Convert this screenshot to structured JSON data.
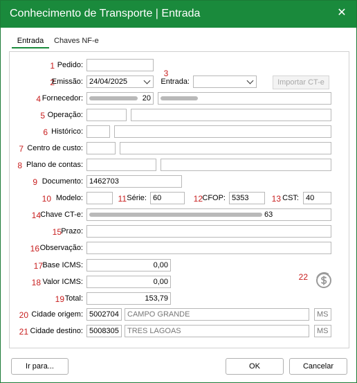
{
  "window": {
    "title": "Conhecimento de Transporte | Entrada",
    "close_icon": "close-icon"
  },
  "tabs": [
    {
      "label": "Entrada",
      "active": true
    },
    {
      "label": "Chaves NF-e",
      "active": false
    }
  ],
  "colors": {
    "titlebar": "#1a8a3c",
    "number": "#c81e1e"
  },
  "form": {
    "pedido": {
      "num": "1",
      "label": "Pedido:",
      "value": ""
    },
    "emissao": {
      "num": "2",
      "label": "Emissão:",
      "value": "24/04/2025"
    },
    "entrada": {
      "num": "3",
      "label": "Entrada:",
      "value": ""
    },
    "importar_label": "Importar CT-e",
    "fornecedor": {
      "num": "4",
      "label": "Fornecedor:",
      "code_suffix": "20"
    },
    "operacao": {
      "num": "5",
      "label": "Operação:"
    },
    "historico": {
      "num": "6",
      "label": "Histórico:"
    },
    "centro_custo": {
      "num": "7",
      "label": "Centro de custo:"
    },
    "plano_contas": {
      "num": "8",
      "label": "Plano de contas:"
    },
    "documento": {
      "num": "9",
      "label": "Documento:",
      "value": "1462703"
    },
    "modelo": {
      "num": "10",
      "label": "Modelo:",
      "value": ""
    },
    "serie": {
      "num": "11",
      "label": "Série:",
      "value": "60"
    },
    "cfop": {
      "num": "12",
      "label": "CFOP:",
      "value": "5353"
    },
    "cst": {
      "num": "13",
      "label": "CST:",
      "value": "40"
    },
    "chave_cte": {
      "num": "14",
      "label": "Chave CT-e:",
      "value_suffix": "63"
    },
    "prazo": {
      "num": "15",
      "label": "Prazo:",
      "value": ""
    },
    "observacao": {
      "num": "16",
      "label": "Observação:",
      "value": ""
    },
    "base_icms": {
      "num": "17",
      "label": "Base ICMS:",
      "value": "0,00"
    },
    "valor_icms": {
      "num": "18",
      "label": "Valor ICMS:",
      "value": "0,00"
    },
    "total": {
      "num": "19",
      "label": "Total:",
      "value": "153,79"
    },
    "cidade_origem": {
      "num": "20",
      "label": "Cidade origem:",
      "code": "5002704",
      "name": "CAMPO GRANDE",
      "uf": "MS"
    },
    "cidade_destino": {
      "num": "21",
      "label": "Cidade destino:",
      "code": "5008305",
      "name": "TRES LAGOAS",
      "uf": "MS"
    },
    "coin_marker": {
      "num": "22",
      "icon": "dollar-refresh-icon"
    }
  },
  "footer": {
    "ir_para": "Ir para...",
    "ok": "OK",
    "cancelar": "Cancelar"
  }
}
